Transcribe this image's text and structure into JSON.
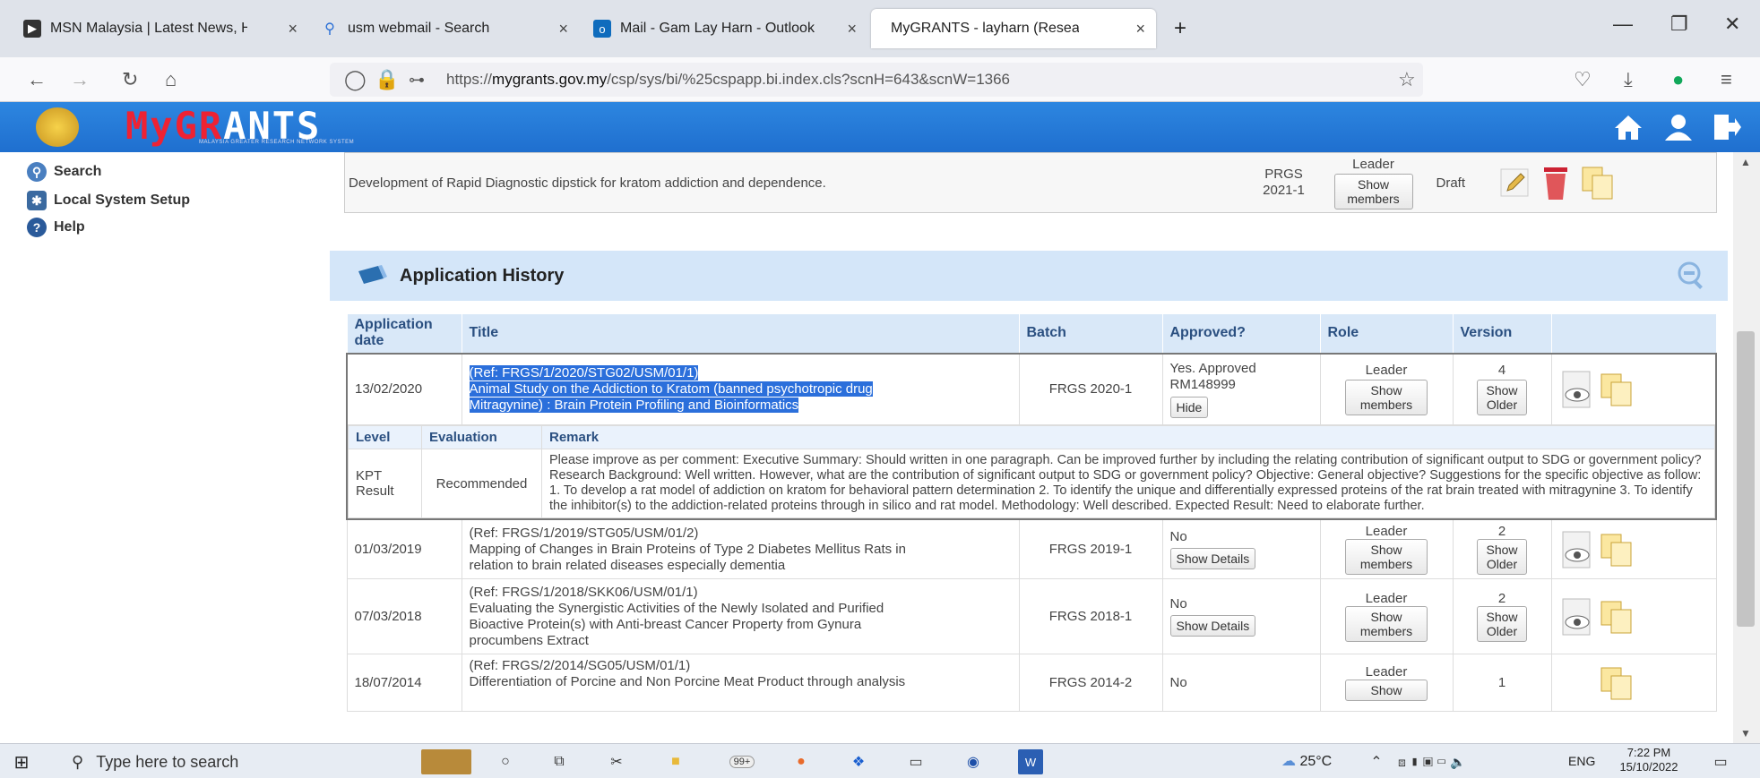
{
  "browser": {
    "tabs": [
      {
        "label": "MSN Malaysia | Latest News, Hc",
        "icon": "msn-icon"
      },
      {
        "label": "usm webmail - Search",
        "icon": "search-icon"
      },
      {
        "label": "Mail - Gam Lay Harn - Outlook",
        "icon": "outlook-icon"
      },
      {
        "label": "MyGRANTS - layharn (Researcher)",
        "icon": "page-icon"
      }
    ],
    "new_tab": "+",
    "close_glyph": "×",
    "url_prefix": "https://",
    "url_domain": "mygrants.gov.my",
    "url_path": "/csp/sys/bi/%25cspapp.bi.index.cls?scnH=643&scnW=1366"
  },
  "app": {
    "logo_text_red": "MyGR",
    "logo_text_white": "ANTS",
    "logo_subtitle": "MALAYSIA GREATER RESEARCH NETWORK SYSTEM"
  },
  "sidebar": {
    "items": [
      {
        "label": "Search",
        "icon": "magnifier-icon"
      },
      {
        "label": "Local System Setup",
        "icon": "puzzle-icon"
      },
      {
        "label": "Help",
        "icon": "help-icon"
      }
    ]
  },
  "draft_row": {
    "title": "Development of Rapid Diagnostic dipstick for kratom addiction and dependence.",
    "batch_line1": "PRGS",
    "batch_line2": "2021-1",
    "role": "Leader",
    "members_btn": "Show members",
    "status": "Draft"
  },
  "history": {
    "title": "Application History",
    "headers": {
      "date": "Application date",
      "title": "Title",
      "batch": "Batch",
      "approved": "Approved?",
      "role": "Role",
      "version": "Version"
    },
    "rows": [
      {
        "date": "13/02/2020",
        "ref": "(Ref: FRGS/1/2020/STG02/USM/01/1)",
        "title1": "Animal Study on the Addiction to Kratom (banned psychotropic drug",
        "title2": "Mitragynine) : Brain Protein Profiling and Bioinformatics",
        "batch": "FRGS 2020-1",
        "approved1": "Yes. Approved",
        "approved2": "RM148999",
        "approved_btn": "Hide",
        "role": "Leader",
        "members_btn": "Show members",
        "version": "4",
        "older_btn": "Show Older"
      },
      {
        "date": "01/03/2019",
        "ref": "(Ref: FRGS/1/2019/STG05/USM/01/2)",
        "title1": "Mapping of Changes in Brain Proteins of Type 2 Diabetes Mellitus Rats in",
        "title2": "relation to brain related diseases especially dementia",
        "batch": "FRGS 2019-1",
        "approved1": "No",
        "approved_btn": "Show Details",
        "role": "Leader",
        "members_btn": "Show members",
        "version": "2",
        "older_btn": "Show Older"
      },
      {
        "date": "07/03/2018",
        "ref": "(Ref: FRGS/1/2018/SKK06/USM/01/1)",
        "title1": "Evaluating the Synergistic Activities of the Newly Isolated and Purified",
        "title2": "Bioactive Protein(s) with Anti-breast Cancer Property from Gynura",
        "title3": "procumbens Extract",
        "batch": "FRGS 2018-1",
        "approved1": "No",
        "approved_btn": "Show Details",
        "role": "Leader",
        "members_btn": "Show members",
        "version": "2",
        "older_btn": "Show Older"
      },
      {
        "date": "18/07/2014",
        "ref": "(Ref: FRGS/2/2014/SG05/USM/01/1)",
        "title1": "Differentiation of Porcine and Non Porcine Meat Product through analysis",
        "batch": "FRGS 2014-2",
        "approved1": "No",
        "role": "Leader",
        "members_btn": "Show",
        "version": "1"
      }
    ],
    "eval": {
      "headers": {
        "level": "Level",
        "evaluation": "Evaluation",
        "remark": "Remark"
      },
      "level": "KPT Result",
      "evaluation": "Recommended",
      "remark": "Please improve as per comment: Executive Summary: Should written in one paragraph. Can be improved further by including the relating contribution of significant output to SDG or government policy? Research Background: Well written. However, what are the contribution of significant output to SDG or government policy? Objective: General objective? Suggestions for the specific objective as follow: 1. To develop a rat model of addiction on kratom for behavioral pattern determination 2. To identify the unique and differentially expressed proteins of the rat brain treated with mitragynine 3. To identify the inhibitor(s) to the addiction-related proteins through in silico and rat model. Methodology: Well described. Expected Result: Need to elaborate further."
    }
  },
  "taskbar": {
    "search_placeholder": "Type here to search",
    "badge": "99+",
    "weather": "25°C",
    "lang": "ENG",
    "time": "7:22 PM",
    "date": "15/10/2022"
  }
}
